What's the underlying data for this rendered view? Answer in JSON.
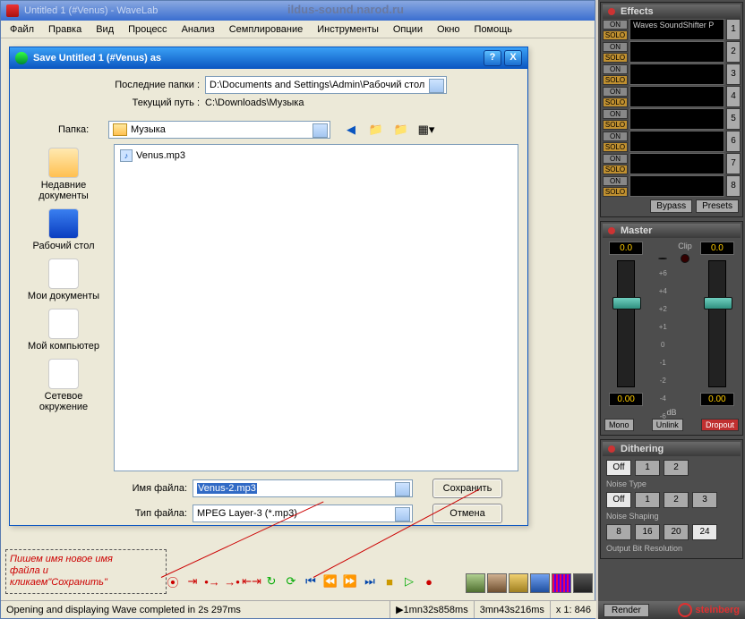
{
  "app": {
    "title": "Untitled 1 (#Venus) - WaveLab",
    "watermark": "ildus-sound.narod.ru"
  },
  "menu": [
    "Файл",
    "Правка",
    "Вид",
    "Процесс",
    "Анализ",
    "Семплирование",
    "Инструменты",
    "Опции",
    "Окно",
    "Помощь"
  ],
  "dialog": {
    "title": "Save Untitled 1 (#Venus) as",
    "recent_label": "Последние папки :",
    "recent_value": "D:\\Documents and Settings\\Admin\\Рабочий стол",
    "path_label": "Текущий путь :",
    "path_value": "C:\\Downloads\\Музыка",
    "folder_label": "Папка:",
    "folder_value": "Музыка",
    "file_in_list": "Venus.mp3",
    "places": {
      "recent": "Недавние документы",
      "desktop": "Рабочий стол",
      "mydocs": "Мои документы",
      "mycomp": "Мой компьютер",
      "network": "Сетевое окружение"
    },
    "filename_label": "Имя файла:",
    "filename_value": "Venus-2.mp3",
    "filetype_label": "Тип файла:",
    "filetype_value": "MPEG Layer-3 (*.mp3)",
    "save_btn": "Сохранить",
    "cancel_btn": "Отмена"
  },
  "annotation": {
    "line1": "Пишем имя новое имя",
    "line2": "файла и",
    "line3": "кликаем\"Сохранить\""
  },
  "status": {
    "main": "Opening and displaying Wave completed in 2s 297ms",
    "t1": "1mn32s858ms",
    "t2": "3mn43s216ms",
    "zoom": "x 1: 846"
  },
  "effects": {
    "title": "Effects",
    "on": "ON",
    "solo": "SOLO",
    "slot1": "Waves SoundShifter P",
    "bypass": "Bypass",
    "presets": "Presets"
  },
  "master": {
    "title": "Master",
    "val_left": "0.0",
    "val_right": "0.0",
    "clip": "Clip",
    "db": "dB",
    "val_bl": "0.00",
    "val_br": "0.00",
    "mono": "Mono",
    "unlink": "Unlink",
    "dropout": "Dropout",
    "scale": [
      "+6",
      "+4",
      "+2",
      "+1",
      "0",
      "-1",
      "-2",
      "-4",
      "-6"
    ]
  },
  "dither": {
    "title": "Dithering",
    "off": "Off",
    "noise_type": "Noise Type",
    "noise_shaping": "Noise Shaping",
    "bit_res": "Output Bit Resolution",
    "nt": [
      "1",
      "2"
    ],
    "ns": [
      "1",
      "2",
      "3"
    ],
    "br": [
      "8",
      "16",
      "20",
      "24"
    ]
  },
  "footer": {
    "render": "Render",
    "brand": "steinberg"
  }
}
